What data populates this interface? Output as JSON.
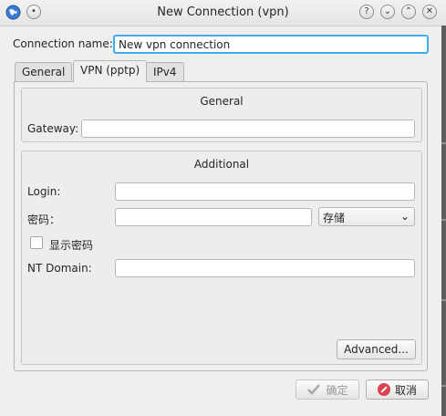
{
  "window": {
    "title": "New Connection (vpn)"
  },
  "icons": {
    "app": "app-globe-icon",
    "pin": "pin-icon",
    "help": "help-icon",
    "minimize": "minimize-icon",
    "maximize": "maximize-icon",
    "close": "close-icon",
    "ok": "checkmark-icon",
    "cancel": "cancel-icon"
  },
  "connection_name": {
    "label": "Connection name:",
    "value": "New vpn connection"
  },
  "tabs": [
    {
      "label": "General"
    },
    {
      "label": "VPN (pptp)"
    },
    {
      "label": "IPv4"
    }
  ],
  "general_section": {
    "title": "General",
    "gateway_label": "Gateway:",
    "gateway_value": ""
  },
  "additional_section": {
    "title": "Additional",
    "login_label": "Login:",
    "login_value": "",
    "password_label": "密码：",
    "password_value": "",
    "password_storage": "存储",
    "show_password_label": "显示密码",
    "show_password_checked": false,
    "nt_domain_label": "NT Domain:",
    "nt_domain_value": "",
    "advanced_button": "Advanced..."
  },
  "buttons": {
    "ok": "确定",
    "cancel": "取消"
  },
  "colors": {
    "focus": "#3daee9",
    "cancel_icon": "#da4453",
    "window_bg": "#f0efee"
  }
}
